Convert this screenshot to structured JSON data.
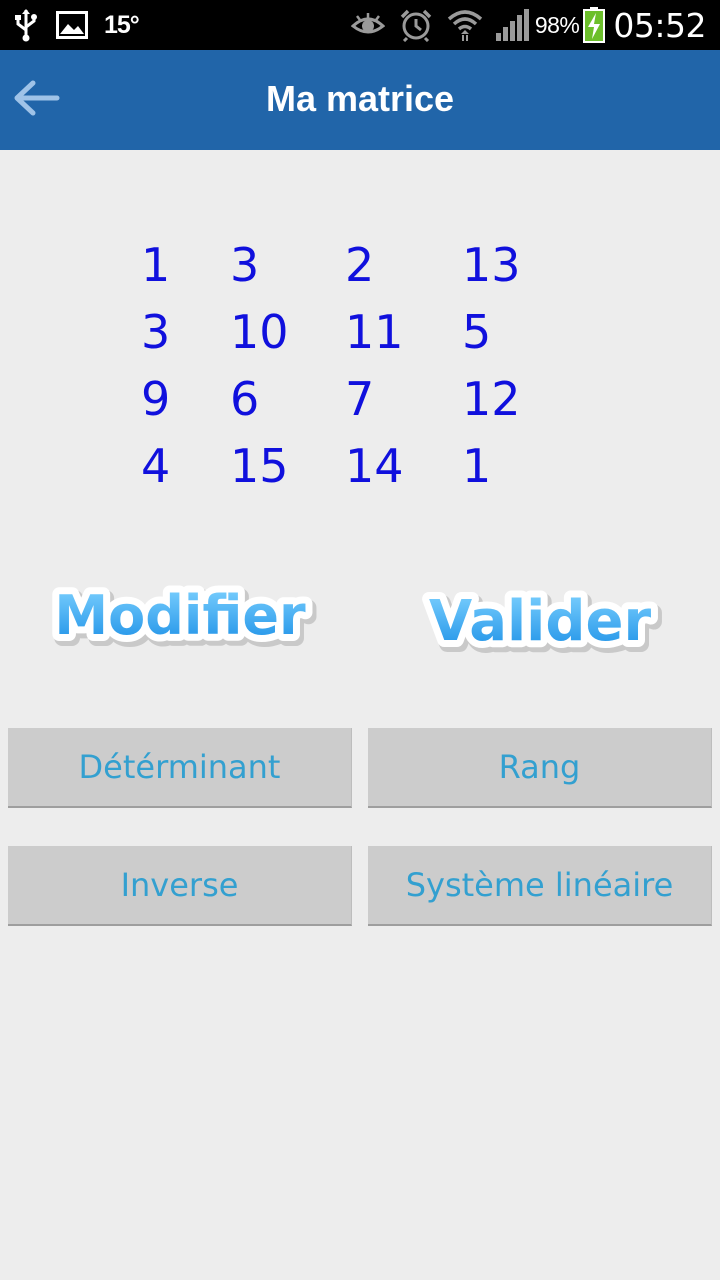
{
  "status_bar": {
    "temperature": "15°",
    "battery_percent": "98%",
    "time": "05:52",
    "icons": [
      "usb-icon",
      "image-icon",
      "eye-icon",
      "alarm-icon",
      "wifi-icon",
      "signal-icon",
      "battery-charging-icon"
    ]
  },
  "action_bar": {
    "back_icon": "arrow-left-icon",
    "title": "Ma matrice",
    "color": "#2165a9"
  },
  "matrix": {
    "rows": [
      [
        "1",
        "3",
        "2",
        "13"
      ],
      [
        "3",
        "10",
        "11",
        "5"
      ],
      [
        "9",
        "6",
        "7",
        "12"
      ],
      [
        "4",
        "15",
        "14",
        "1"
      ]
    ],
    "color": "#1010dd"
  },
  "logo_buttons": {
    "modifier_label": "Modifier",
    "valider_label": "Valider"
  },
  "buttons": {
    "determinant": "Détérminant",
    "rang": "Rang",
    "inverse": "Inverse",
    "systeme_lineaire": "Système linéaire",
    "text_color": "#33a0d0"
  }
}
